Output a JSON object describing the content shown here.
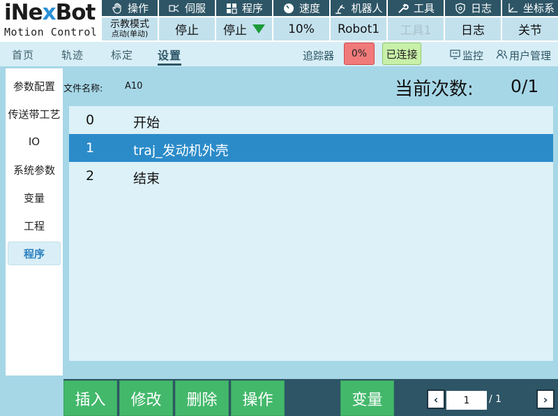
{
  "logo": {
    "brand_a": "iNe",
    "brand_x": "x",
    "brand_b": "Bot",
    "sub": "Motion Control"
  },
  "menu": [
    {
      "label": "操作",
      "icon": "hand-icon"
    },
    {
      "label": "伺服",
      "icon": "servo-icon"
    },
    {
      "label": "程序",
      "icon": "grid-icon"
    },
    {
      "label": "速度",
      "icon": "gauge-icon"
    },
    {
      "label": "机器人",
      "icon": "robot-arm-icon"
    },
    {
      "label": "工具",
      "icon": "wrench-icon"
    },
    {
      "label": "日志",
      "icon": "shield-icon"
    },
    {
      "label": "坐标系",
      "icon": "axis-icon"
    }
  ],
  "status": {
    "mode_line1": "示教模式",
    "mode_line2": "点动(单动)",
    "servo": "停止",
    "program": "停止",
    "speed": "10%",
    "robot": "Robot1",
    "tool": "工具1",
    "log": "日志",
    "coord": "关节"
  },
  "nav": {
    "tabs": [
      "首页",
      "轨迹",
      "标定",
      "设置"
    ],
    "active": "设置",
    "tracker_label": "追踪器",
    "tracker_value": "0%",
    "connected": "已连接",
    "monitor": "监控",
    "user_mgmt": "用户管理"
  },
  "sidebar": {
    "items": [
      "参数配置",
      "传送带工艺",
      "IO",
      "系统参数",
      "变量",
      "工程",
      "程序"
    ],
    "active": "程序"
  },
  "file": {
    "label": "文件名称:",
    "value": "A10"
  },
  "count": {
    "label": "当前次数:",
    "value": "0/1"
  },
  "program_rows": [
    {
      "index": "0",
      "command": "开始"
    },
    {
      "index": "1",
      "command": "traj_发动机外壳"
    },
    {
      "index": "2",
      "command": "结束"
    }
  ],
  "selected_row": "1",
  "actions": {
    "insert": "插入",
    "modify": "修改",
    "delete": "删除",
    "operate": "操作",
    "variable": "变量"
  },
  "pager": {
    "current": "1",
    "total": "/ 1",
    "prev": "‹",
    "next": "›"
  },
  "colors": {
    "header_dark": "#2d5566",
    "status_cell": "#c3e1ed",
    "main_bg": "#a6d7e7",
    "selected_row": "#2b8bc9",
    "action_green": "#43b86b",
    "tracker_red": "#f07a7a",
    "connected_green": "#c8f0a8"
  }
}
